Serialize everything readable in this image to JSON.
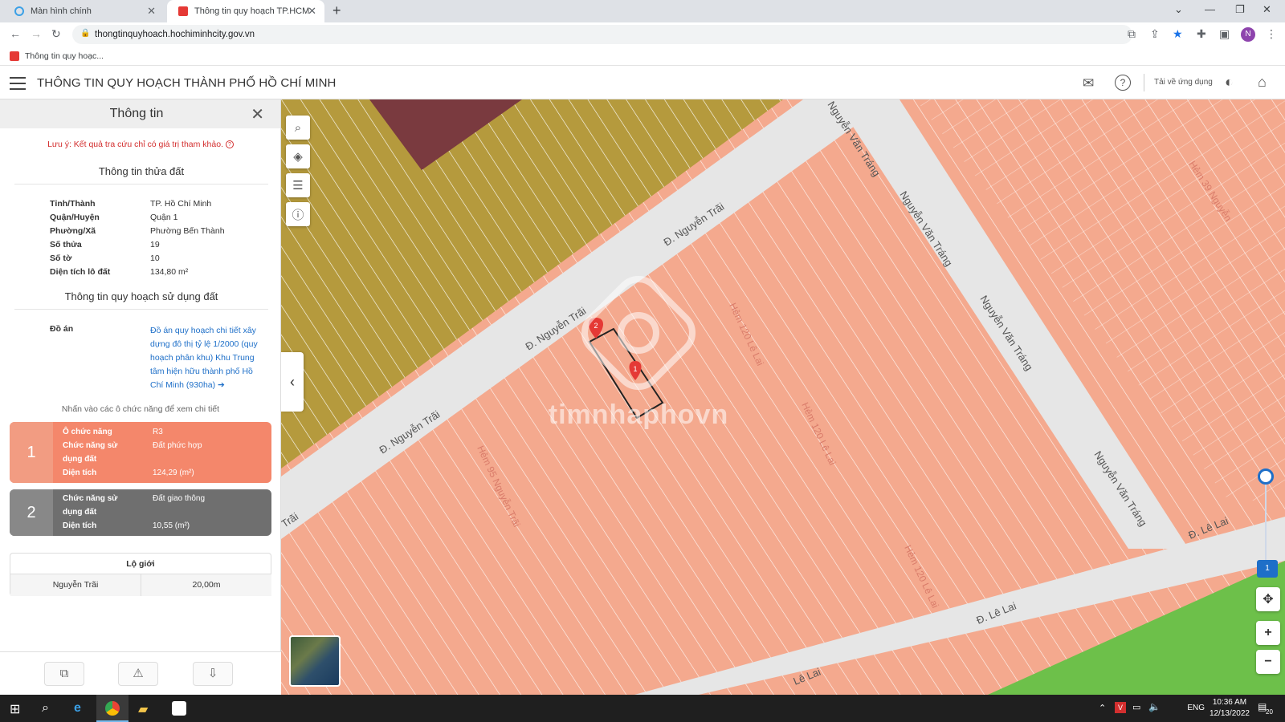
{
  "browser": {
    "tabs": [
      {
        "label": "Màn hình chính",
        "fav_color": "#3ba0e6"
      },
      {
        "label": "Thông tin quy hoạch TP.HCM",
        "fav_color": "#e53935"
      }
    ],
    "url": "thongtinquyhoach.hochiminhcity.gov.vn",
    "bookmark": "Thông tin quy hoạc...",
    "profile_initial": "N"
  },
  "app": {
    "title": "THÔNG TIN QUY HOẠCH THÀNH PHỐ HỒ CHÍ MINH",
    "download_label": "Tải về ứng dụng"
  },
  "panel": {
    "title": "Thông tin",
    "note": "Lưu ý: Kết quả tra cứu chỉ có giá trị tham khảo.",
    "parcel_section": "Thông tin thửa đất",
    "parcel": [
      {
        "k": "Tỉnh/Thành",
        "v": "TP. Hồ Chí Minh"
      },
      {
        "k": "Quận/Huyện",
        "v": "Quận 1"
      },
      {
        "k": "Phường/Xã",
        "v": "Phường Bến Thành"
      },
      {
        "k": "Số thửa",
        "v": "19"
      },
      {
        "k": "Số tờ",
        "v": "10"
      },
      {
        "k": "Diện tích lô đất",
        "v": "134,80 m²"
      }
    ],
    "planning_section": "Thông tin quy hoạch sử dụng đất",
    "doan_label": "Đồ án",
    "doan_text": "Đồ án quy hoạch chi tiết xây dựng đô thị tỷ lệ 1/2000 (quy hoạch phân khu) Khu Trung tâm hiện hữu thành phố Hồ Chí Minh (930ha) ➔",
    "hint": "Nhấn vào các ô chức năng để xem chi tiết",
    "zones": [
      {
        "num": "1",
        "color": "#f4876b",
        "num_color": "#f29c82",
        "rows": [
          {
            "k": "Ô chức năng",
            "v": "R3"
          },
          {
            "k": "Chức năng sử",
            "v": "Đất phức hợp"
          },
          {
            "k": "dụng đất",
            "v": ""
          },
          {
            "k": "Diện tích",
            "v": "124,29 (m²)"
          }
        ]
      },
      {
        "num": "2",
        "color": "#6f6f6f",
        "num_color": "#888888",
        "rows": [
          {
            "k": "Chức năng sử",
            "v": "Đất giao thông"
          },
          {
            "k": "dụng đất",
            "v": ""
          },
          {
            "k": "Diện tích",
            "v": "10,55 (m²)"
          }
        ]
      }
    ],
    "logioi": {
      "title": "Lộ giới",
      "street": "Nguyễn Trãi",
      "width": "20,00m"
    }
  },
  "map": {
    "streets": {
      "nguyen_trai_1": "Đ. Nguyễn Trãi",
      "nguyen_trai_2": "Đ. Nguyễn Trãi",
      "nguyen_trai_3": "Đ. Nguyễn Trãi",
      "trai_edge": "Trãi",
      "nvt_1": "Nguyễn Văn Tráng",
      "nvt_2": "Nguyễn Văn Tráng",
      "nvt_3": "Nguyễn Văn Tráng",
      "nvt_top": "Nguyễn Văn Tráng",
      "le_lai_1": "Đ. Lê Lai",
      "le_lai_2": "Đ. Lê Lai",
      "le_lai_3": "Lê Lai"
    },
    "alleys": {
      "h95": "Hẻm 95 Nguyễn Trãi",
      "h120": "Hẻm 120 Lê Lai",
      "h_mid1": "Hẻm 120 Lê Lai",
      "h_mid2": "Hẻm 120 Lê Lai",
      "h39": "Hẻm 39 Nguyễn"
    },
    "watermark": "timnhaphovn",
    "marker_1": "1",
    "marker_2": "2",
    "zoom_level": "1",
    "colors": {
      "residential": "#f4a98e",
      "commercial": "#b59a3d",
      "road": "#e6e6e6",
      "park": "#6dc04a",
      "special": "#7a3a3f"
    }
  },
  "taskbar": {
    "lang": "ENG",
    "time": "10:36 AM",
    "date": "12/13/2022",
    "notif": "20"
  }
}
